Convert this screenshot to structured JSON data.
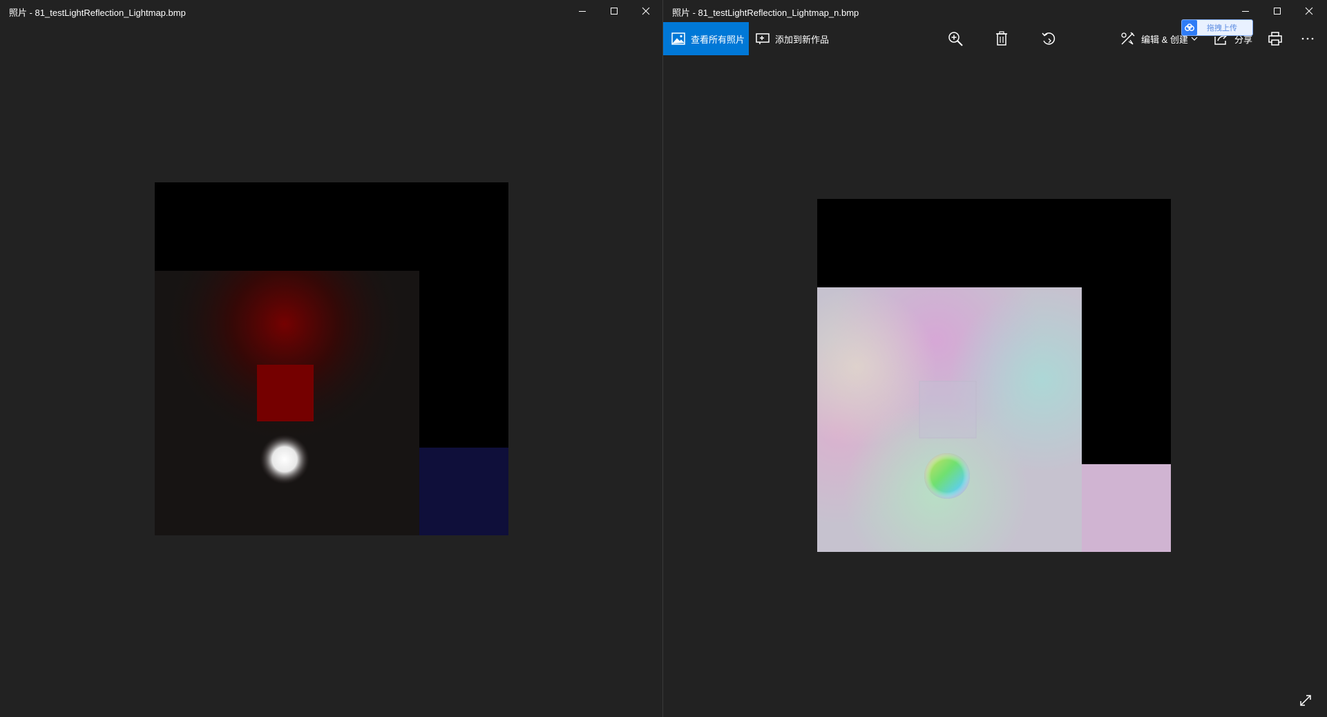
{
  "left_window": {
    "title": "照片 - 81_testLightReflection_Lightmap.bmp",
    "icons": [
      "minimize-icon",
      "maximize-icon",
      "close-icon"
    ],
    "image": {
      "colors": {
        "background": "#000000",
        "floor": "#171413",
        "red_glow": "#7a0000",
        "red_square": "#750000",
        "sphere": "#ffffff",
        "blue_strip": "#0f0f3a"
      }
    }
  },
  "right_window": {
    "title": "照片 - 81_testLightReflection_Lightmap_n.bmp",
    "icons": [
      "minimize-icon",
      "maximize-icon",
      "close-icon"
    ],
    "toolbar": {
      "see_all_label": "查看所有照片",
      "add_to_creation_label": "添加到新作品",
      "edit_create_label": "编辑 & 创建",
      "share_label": "分享",
      "badge_label": "拖拽上传",
      "accent_color": "#0078d7",
      "icons": [
        "photos-icon",
        "add-creation-icon",
        "zoom-icon",
        "delete-icon",
        "rotate-icon",
        "edit-create-icon",
        "chevron-down-icon",
        "share-icon",
        "print-icon",
        "more-icon",
        "baidu-cloud-icon",
        "fullscreen-icon"
      ]
    },
    "image": {
      "colors": {
        "background": "#000000",
        "floor": "#c6c2cf",
        "pink_strip": "#d0b4d2"
      }
    }
  }
}
